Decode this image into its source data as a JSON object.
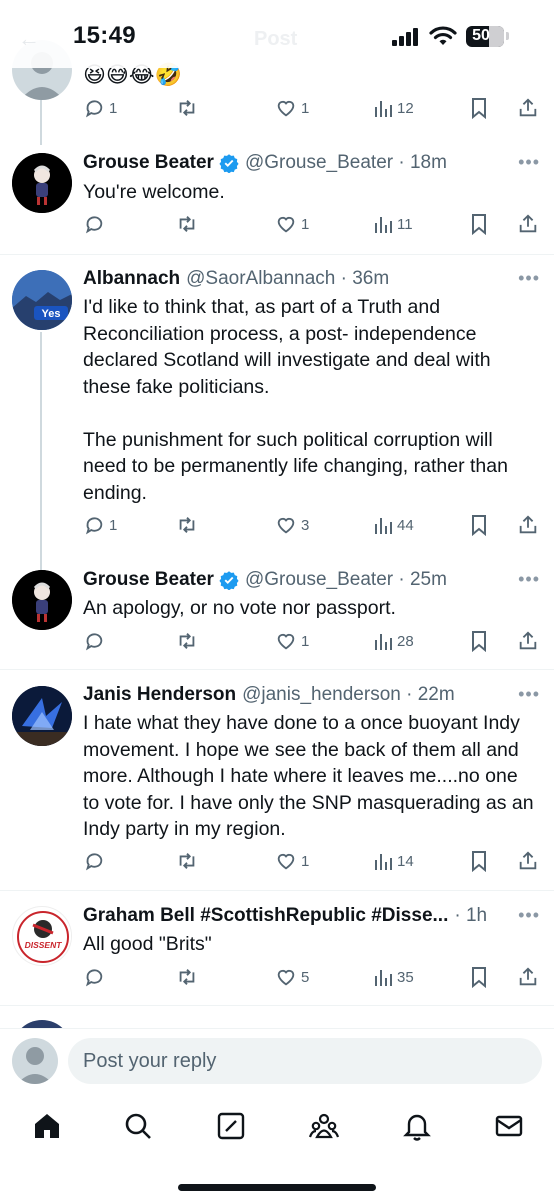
{
  "status_bar": {
    "time": "15:49",
    "battery": "50",
    "ghost_title": "Post",
    "ghost_back": "←"
  },
  "tweets": [
    {
      "emoji": "😆😅😂🤣",
      "actions": {
        "replies": "1",
        "retweets": "",
        "likes": "1",
        "views": "12"
      }
    },
    {
      "name": "Grouse Beater",
      "verified": true,
      "handle": "@Grouse_Beater · 18m",
      "text": "You're welcome.",
      "actions": {
        "replies": "",
        "retweets": "",
        "likes": "1",
        "views": "11"
      }
    },
    {
      "name": "Albannach",
      "verified": false,
      "handle": "@SaorAlbannach · 36m",
      "avatar_text": "Yes",
      "text": "I'd like to think that, as part of a Truth and Reconciliation process, a post- independence declared Scotland will investigate and deal with these fake politicians.\n\nThe punishment for such political corruption will need to be permanently life changing, rather than ending.",
      "actions": {
        "replies": "1",
        "retweets": "",
        "likes": "3",
        "views": "44"
      }
    },
    {
      "name": "Grouse Beater",
      "verified": true,
      "handle": "@Grouse_Beater · 25m",
      "text": "An apology, or no vote nor passport.",
      "actions": {
        "replies": "",
        "retweets": "",
        "likes": "1",
        "views": "28"
      }
    },
    {
      "name": "Janis Henderson",
      "verified": false,
      "handle": "@janis_henderson · 22m",
      "text": "I hate what they have done to a once buoyant Indy movement. I hope we see the back of them all and more.  Although I hate where it leaves me....no one to vote for. I have only the SNP masquerading as an Indy party in my region.",
      "actions": {
        "replies": "",
        "retweets": "",
        "likes": "1",
        "views": "14"
      }
    },
    {
      "name": "Graham Bell #ScottishRepublic #Disse...",
      "verified": false,
      "handle": "· 1h",
      "avatar_text": "DISSENT",
      "text": "All good \"Brits\"",
      "actions": {
        "replies": "",
        "retweets": "",
        "likes": "5",
        "views": "35"
      }
    }
  ],
  "reply_bar": {
    "placeholder": "Post your reply"
  },
  "tabs": [
    "home-icon",
    "search-icon",
    "grok-icon",
    "communities-icon",
    "notifications-icon",
    "messages-icon"
  ],
  "colors": {
    "verified": "#1d9bf0",
    "text": "#0f1419",
    "secondary": "#536471",
    "divider": "#eff3f4"
  }
}
